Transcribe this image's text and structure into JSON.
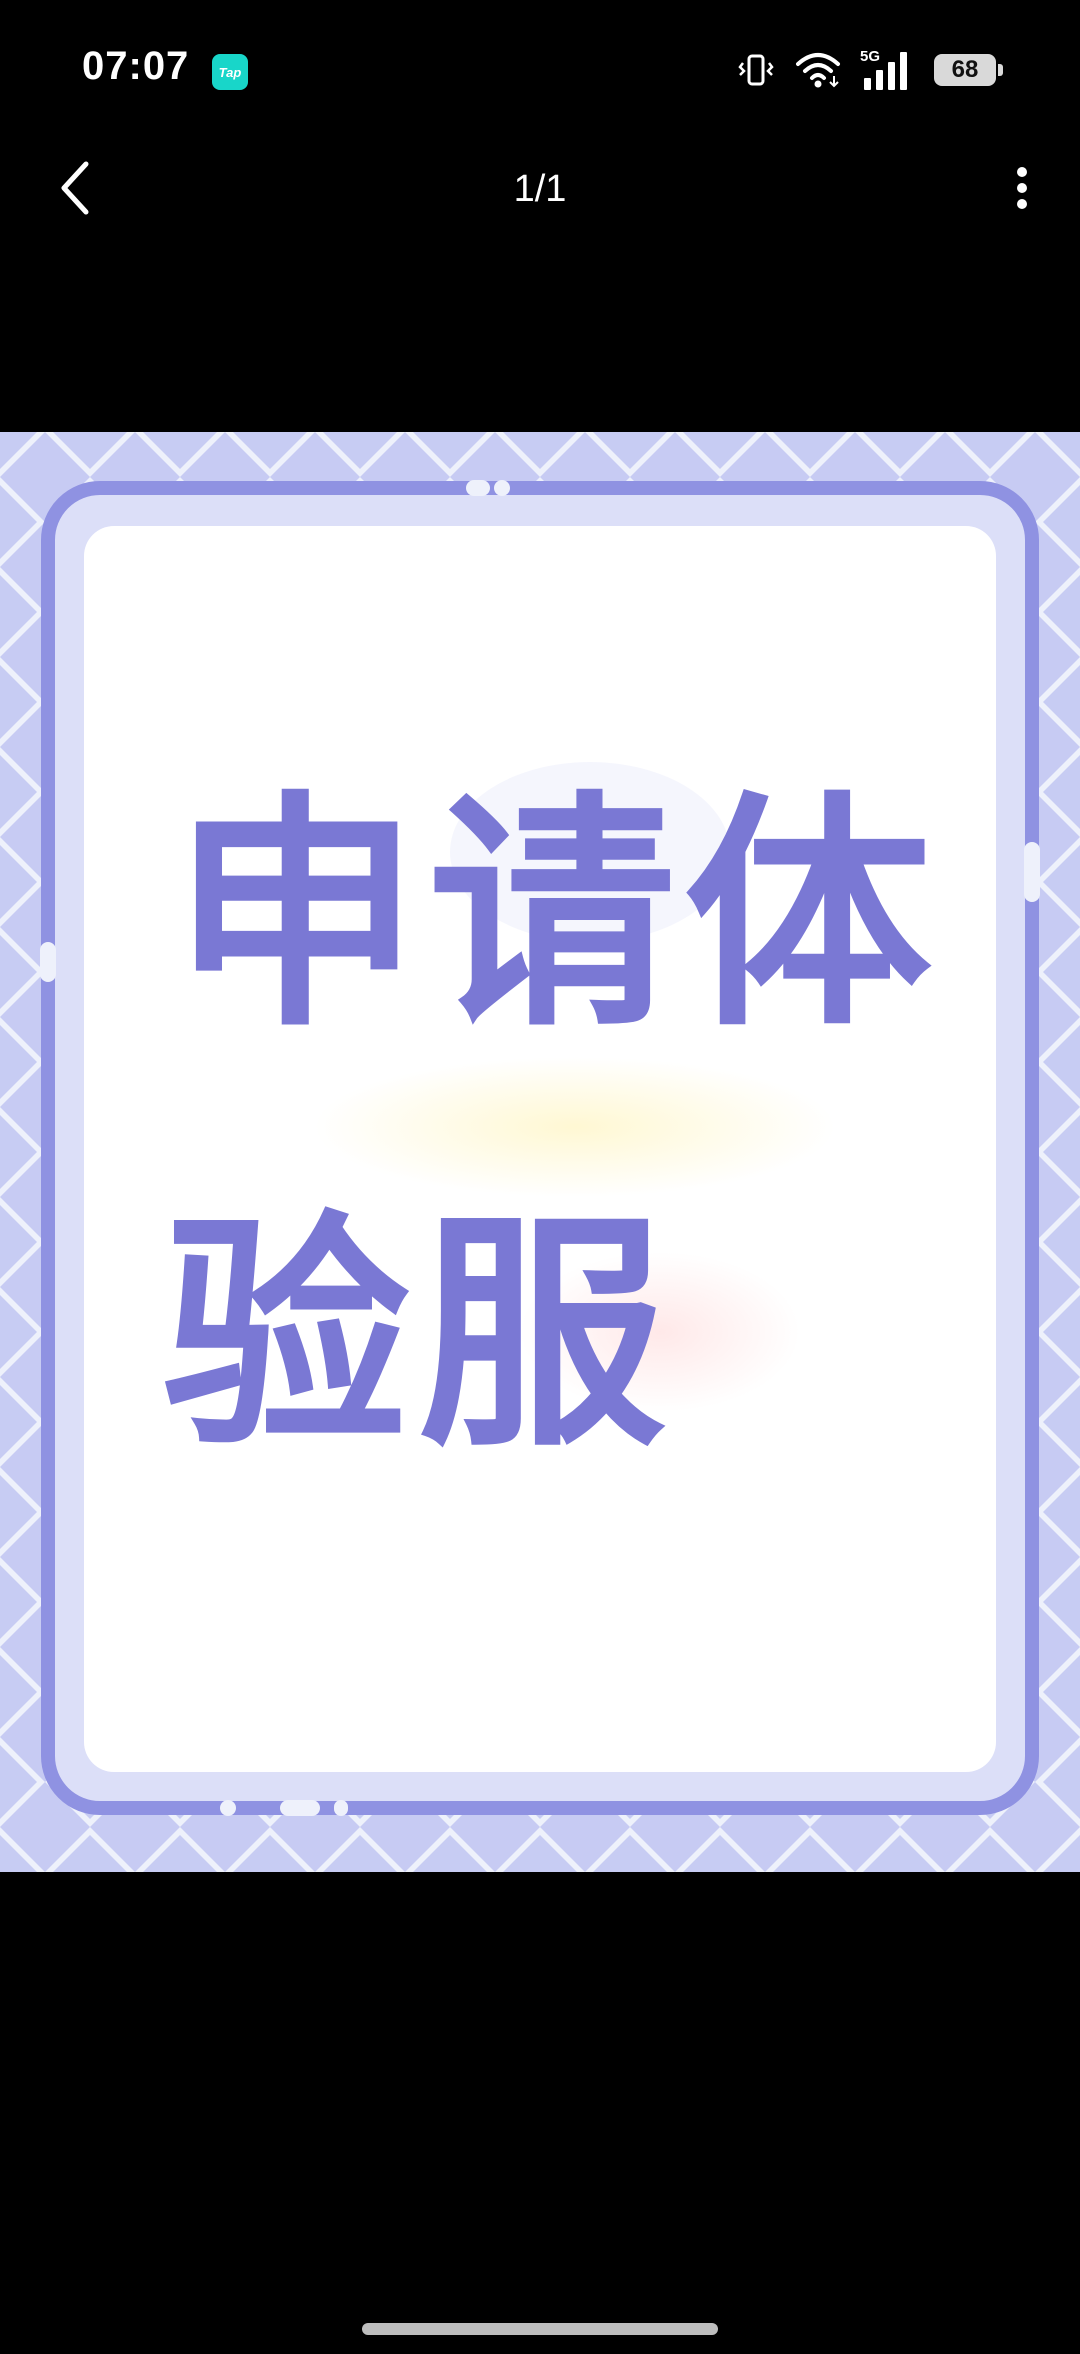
{
  "status_bar": {
    "time": "07:07",
    "app_badge": "Tap",
    "network_label": "5G",
    "battery_level": "68"
  },
  "nav": {
    "page_counter": "1/1"
  },
  "poster": {
    "line_1": "申请体",
    "line_2": "验服"
  },
  "colors": {
    "accent": "#7a78d4",
    "frame_light": "#c9cdf4",
    "background": "#000000"
  },
  "icons": {
    "back": "chevron-left-icon",
    "more": "more-vertical-icon",
    "vibrate": "vibrate-icon",
    "wifi": "wifi-icon",
    "signal": "signal-icon",
    "battery": "battery-icon"
  }
}
